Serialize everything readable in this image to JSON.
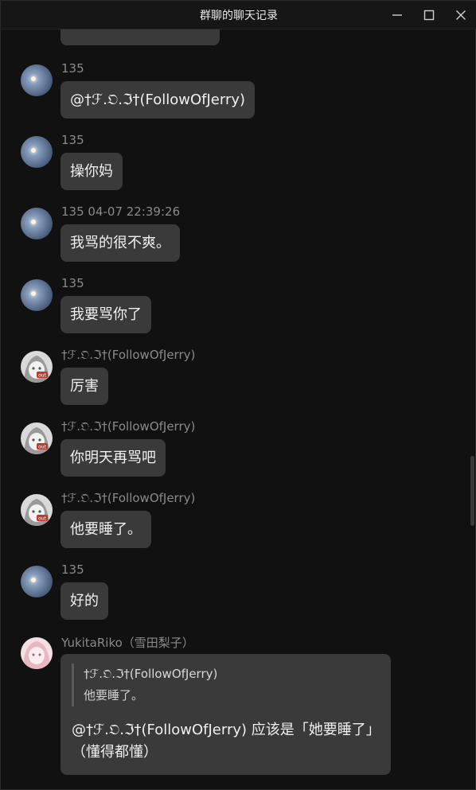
{
  "window": {
    "title": "群聊的聊天记录"
  },
  "icons": {
    "minimize": "minimize-icon",
    "maximize": "maximize-icon",
    "close": "close-icon",
    "avatar_135": "avatar-sky",
    "avatar_jerry": "avatar-anime-grey",
    "avatar_riko": "avatar-anime-pink"
  },
  "colors": {
    "background": "#111111",
    "bubble": "#3a3a3a",
    "sender": "#8a8a8a"
  },
  "messages": [
    {
      "sender": "135",
      "text": "@†ℱ.𝔒.ℑ†(FollowOfJerry)"
    },
    {
      "sender": "135",
      "text": "操你妈"
    },
    {
      "sender": "135 04-07 22:39:26",
      "text": "我骂的很不爽。"
    },
    {
      "sender": "135",
      "text": "我要骂你了"
    },
    {
      "sender": "†ℱ.𝔒.ℑ†(FollowOfJerry)",
      "text": "厉害"
    },
    {
      "sender": "†ℱ.𝔒.ℑ†(FollowOfJerry)",
      "text": "你明天再骂吧"
    },
    {
      "sender": "†ℱ.𝔒.ℑ†(FollowOfJerry)",
      "text": "他要睡了。"
    },
    {
      "sender": "135",
      "text": "好的"
    },
    {
      "sender": "YukitaRiko（雪田梨子）",
      "quote_sender": "†ℱ.𝔒.ℑ†(FollowOfJerry)",
      "quote_text": "他要睡了。",
      "text": "@†ℱ.𝔒.ℑ†(FollowOfJerry) 应该是「她要睡了」（懂得都懂）"
    }
  ]
}
